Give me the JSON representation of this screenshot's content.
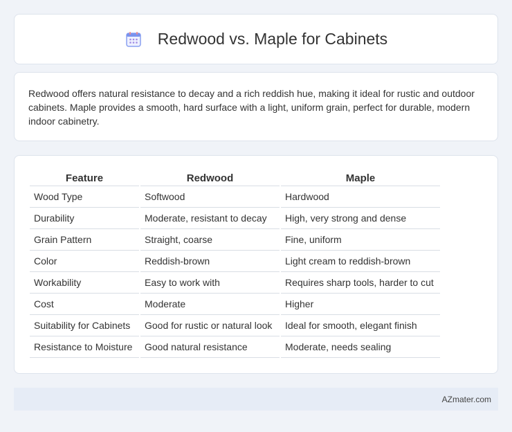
{
  "header": {
    "title": "Redwood vs. Maple for Cabinets",
    "icon": "calendar-icon",
    "icon_colors": {
      "frame": "#6c8ef5",
      "top": "#f08a8a",
      "dots": "#9f86e0"
    }
  },
  "description": "Redwood offers natural resistance to decay and a rich reddish hue, making it ideal for rustic and outdoor cabinets. Maple provides a smooth, hard surface with a light, uniform grain, perfect for durable, modern indoor cabinetry.",
  "table": {
    "headers": [
      "Feature",
      "Redwood",
      "Maple"
    ],
    "rows": [
      [
        "Wood Type",
        "Softwood",
        "Hardwood"
      ],
      [
        "Durability",
        "Moderate, resistant to decay",
        "High, very strong and dense"
      ],
      [
        "Grain Pattern",
        "Straight, coarse",
        "Fine, uniform"
      ],
      [
        "Color",
        "Reddish-brown",
        "Light cream to reddish-brown"
      ],
      [
        "Workability",
        "Easy to work with",
        "Requires sharp tools, harder to cut"
      ],
      [
        "Cost",
        "Moderate",
        "Higher"
      ],
      [
        "Suitability for Cabinets",
        "Good for rustic or natural look",
        "Ideal for smooth, elegant finish"
      ],
      [
        "Resistance to Moisture",
        "Good natural resistance",
        "Moderate, needs sealing"
      ]
    ]
  },
  "footer": {
    "site": "AZmater.com"
  }
}
